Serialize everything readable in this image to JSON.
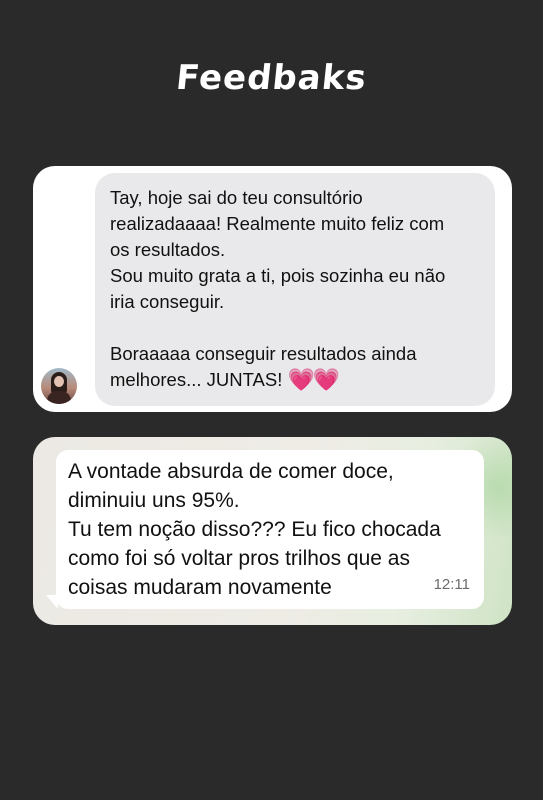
{
  "page": {
    "title": "Feedbaks"
  },
  "card1": {
    "lines": [
      "Tay, hoje sai do teu consultório",
      "realizadaaaa! Realmente muito feliz com",
      "os resultados.",
      "Sou muito grata a ti, pois sozinha eu não",
      "iria conseguir.",
      "Boraaaaa conseguir resultados ainda",
      "melhores... JUNTAS!"
    ],
    "hearts": "💗💗",
    "avatar_icon": "profile-photo"
  },
  "card2": {
    "lines": [
      "A vontade absurda de comer doce,",
      "diminuiu uns 95%.",
      "Tu tem noção disso??? Eu fico chocada",
      "como foi só voltar pros trilhos que as",
      "coisas mudaram novamente"
    ],
    "time": "12:11"
  },
  "colors": {
    "background": "#2a2a2a",
    "bubble_gray": "#e9e9eb",
    "heart_pink": "#ff2fb4"
  }
}
